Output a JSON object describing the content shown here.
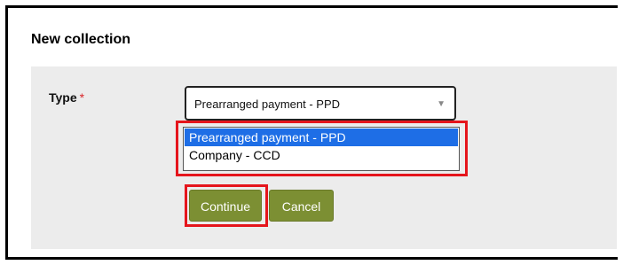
{
  "dialog": {
    "title": "New collection"
  },
  "form": {
    "type_label": "Type",
    "required_marker": "*",
    "type_select": {
      "value": "Prearranged payment - PPD",
      "arrow_icon": "chevron-down-icon",
      "options": [
        {
          "label": "Prearranged payment - PPD",
          "selected": true
        },
        {
          "label": "Company - CCD",
          "selected": false
        }
      ]
    }
  },
  "actions": {
    "continue_label": "Continue",
    "cancel_label": "Cancel"
  },
  "colors": {
    "button_bg": "#7c8f33",
    "highlight": "#e5151c",
    "option_selected": "#1e6ee6",
    "panel_bg": "#ececec",
    "required": "#d9262b"
  }
}
